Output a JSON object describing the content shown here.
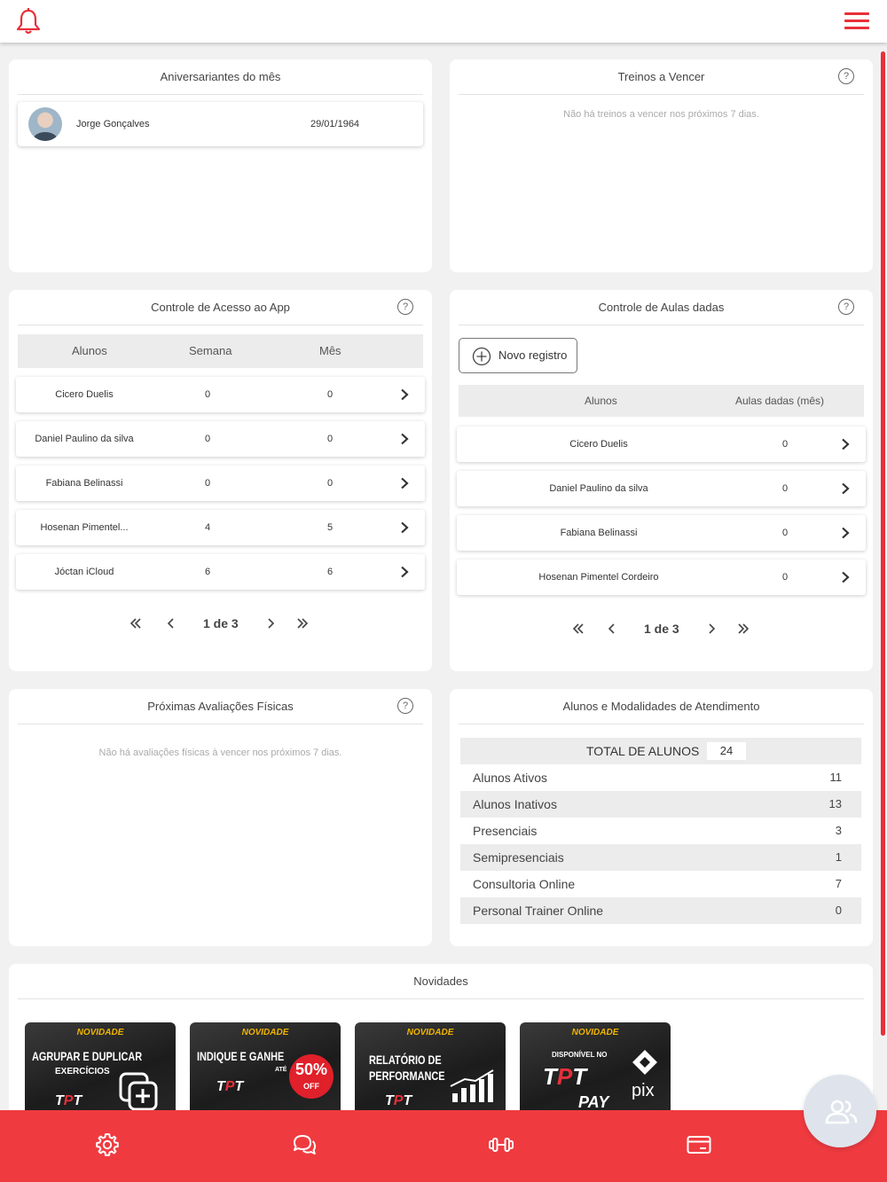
{
  "header": {
    "notifications_icon": "bell-icon",
    "menu_icon": "hamburger-menu-icon",
    "accent": "#e8303a"
  },
  "birthdays": {
    "title": "Aniversariantes do mês",
    "items": [
      {
        "name": "Jorge  Gonçalves",
        "date": "29/01/1964"
      }
    ]
  },
  "expiring_workouts": {
    "title": "Treinos a Vencer",
    "help": "?",
    "empty": "Não há treinos a vencer nos próximos 7 dias."
  },
  "app_access": {
    "title": "Controle de Acesso ao App",
    "help": "?",
    "columns": [
      "Alunos",
      "Semana",
      "Mês"
    ],
    "rows": [
      {
        "name": "Cicero Duelis",
        "week": "0",
        "month": "0"
      },
      {
        "name": "Daniel Paulino da silva",
        "week": "0",
        "month": "0"
      },
      {
        "name": "Fabiana Belinassi",
        "week": "0",
        "month": "0"
      },
      {
        "name": "Hosenan Pimentel...",
        "week": "4",
        "month": "5"
      },
      {
        "name": "Jóctan iCloud",
        "week": "6",
        "month": "6"
      }
    ],
    "pager": "1 de 3"
  },
  "classes_given": {
    "title": "Controle de Aulas dadas",
    "help": "?",
    "new_button": "Novo registro",
    "columns": [
      "Alunos",
      "Aulas dadas (mês)"
    ],
    "rows": [
      {
        "name": "Cicero Duelis",
        "count": "0"
      },
      {
        "name": "Daniel Paulino da silva",
        "count": "0"
      },
      {
        "name": "Fabiana Belinassi",
        "count": "0"
      },
      {
        "name": "Hosenan Pimentel Cordeiro",
        "count": "0"
      }
    ],
    "pager": "1 de 3"
  },
  "assessments": {
    "title": "Próximas Avaliações Físicas",
    "help": "?",
    "empty": "Não há avaliações físicas à vencer nos próximos 7 dias."
  },
  "students_summary": {
    "title": "Alunos e Modalidades de Atendimento",
    "total_label": "TOTAL DE ALUNOS",
    "total_value": "24",
    "rows": [
      {
        "label": "Alunos Ativos",
        "value": "11"
      },
      {
        "label": "Alunos Inativos",
        "value": "13"
      },
      {
        "label": "Presenciais",
        "value": "3"
      },
      {
        "label": "Semipresenciais",
        "value": "1"
      },
      {
        "label": "Consultoria Online",
        "value": "7"
      },
      {
        "label": "Personal Trainer Online",
        "value": "0"
      }
    ]
  },
  "news": {
    "title": "Novidades",
    "cards": [
      {
        "badge": "NOVIDADE",
        "title": "AGRUPAR E DUPLICAR",
        "subtitle": "EXERCÍCIOS",
        "logo_a": "T",
        "logo_b": "P",
        "logo_c": "T"
      },
      {
        "badge": "NOVIDADE",
        "title": "INDIQUE E GANHE",
        "subtitle": "ATÉ",
        "discount": "50%",
        "off": "OFF",
        "logo_a": "T",
        "logo_b": "P",
        "logo_c": "T"
      },
      {
        "badge": "NOVIDADE",
        "title": "RELATÓRIO DE",
        "title2": "PERFORMANCE",
        "logo_a": "T",
        "logo_b": "P",
        "logo_c": "T"
      },
      {
        "badge": "NOVIDADE",
        "title": "DISPONÍVEL NO",
        "pix": "pix",
        "pay": "PAY",
        "logo_a": "T",
        "logo_b": "P",
        "logo_c": "T"
      }
    ]
  },
  "bottom_nav": {
    "items": [
      "gear-icon",
      "chat-icon",
      "dumbbell-icon",
      "credit-card-icon"
    ]
  },
  "fab": {
    "icon": "users-icon"
  }
}
